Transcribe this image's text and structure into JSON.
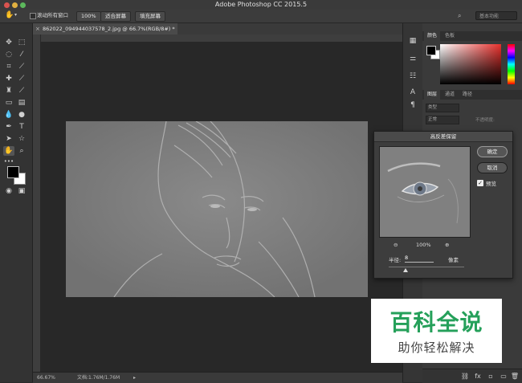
{
  "app": {
    "title": "Adobe Photoshop CC 2015.5"
  },
  "options_bar": {
    "scroll_all_windows": "滚动所有窗口",
    "zoom_100": "100%",
    "fit_screen": "适合屏幕",
    "fill_screen": "填充屏幕",
    "workspace": "基本功能"
  },
  "document": {
    "tab_title": "862022_094944037578_2.jpg @ 66.7%(RGB/8#) *",
    "close": "×"
  },
  "status_bar": {
    "zoom": "66.67%",
    "doc_size": "文档:1.76M/1.76M"
  },
  "color_panel": {
    "tabs": [
      "颜色",
      "色板"
    ]
  },
  "layers_panel": {
    "tabs": [
      "图层",
      "通道",
      "路径"
    ],
    "kind": "类型",
    "mode": "正常",
    "opacity_label": "不透明度:"
  },
  "dialog": {
    "title": "高反差保留",
    "ok": "确定",
    "cancel": "取消",
    "preview": "预览",
    "preview_checked": true,
    "zoom": "100%",
    "radius_label": "半径:",
    "radius_value": "8",
    "radius_unit": "像素",
    "slider_fraction": 0.22
  },
  "watermark": {
    "title": "百科全说",
    "subtitle": "助你轻松解决"
  },
  "colors": {
    "foreground": "#000000",
    "background": "#ffffff",
    "accent_green": "#25a05a"
  }
}
